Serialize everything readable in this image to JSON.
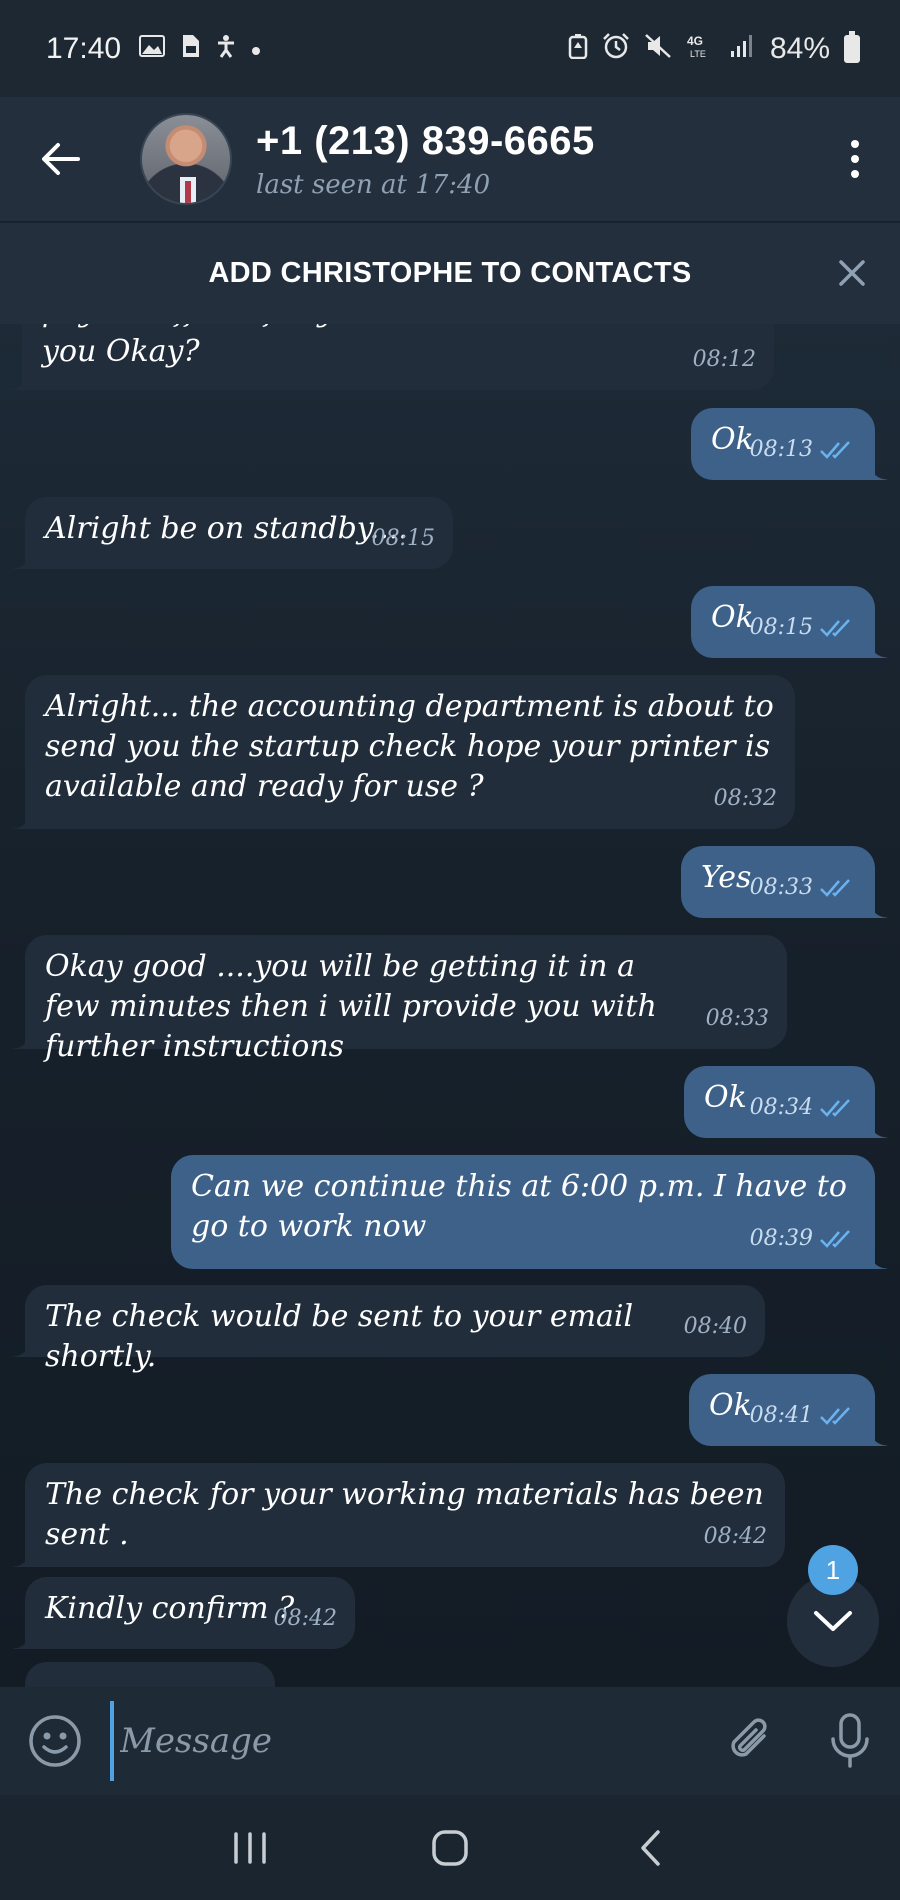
{
  "status_bar": {
    "time": "17:40",
    "left_icons": [
      "image-icon",
      "sim-icon",
      "accessibility-icon",
      "dot-icon"
    ],
    "right_icons": [
      "battery-saver-icon",
      "alarm-icon",
      "mute-icon",
      "4g-lte-icon",
      "signal-icon"
    ],
    "battery": "84%"
  },
  "header": {
    "contact_name": "+1 (213) 839-6665",
    "last_seen": "last seen at 17:40"
  },
  "add_contact": {
    "label": "ADD CHRISTOPHE TO CONTACTS"
  },
  "messages": [
    {
      "dir": "in",
      "text": "payroll officer for your check to be emailed to you Okay?",
      "time": "08:12"
    },
    {
      "dir": "out",
      "text": "Ok",
      "time": "08:13"
    },
    {
      "dir": "in",
      "text": "Alright be on standby....",
      "time": "08:15"
    },
    {
      "dir": "out",
      "text": "Ok",
      "time": "08:15"
    },
    {
      "dir": "in",
      "text": "Alright... the accounting department is about to send you the startup check hope your printer is available and ready for use ?",
      "time": "08:32"
    },
    {
      "dir": "out",
      "text": "Yes",
      "time": "08:33"
    },
    {
      "dir": "in",
      "text": "Okay good ....you will be getting it in a few minutes then i will provide you with further instructions",
      "time": "08:33"
    },
    {
      "dir": "out",
      "text": "Ok",
      "time": "08:34"
    },
    {
      "dir": "out",
      "text": "Can we continue this at 6:00 p.m. I have to go to work now",
      "time": "08:39"
    },
    {
      "dir": "in",
      "text": "The check would be sent to your email shortly.",
      "time": "08:40"
    },
    {
      "dir": "out",
      "text": "Ok",
      "time": "08:41"
    },
    {
      "dir": "in",
      "text": "The check for your working materials has been sent .",
      "time": "08:42"
    },
    {
      "dir": "in",
      "text": "Kindly confirm ?",
      "time": "08:42"
    }
  ],
  "scroll": {
    "unread_count": "1"
  },
  "input": {
    "placeholder": "Message"
  }
}
